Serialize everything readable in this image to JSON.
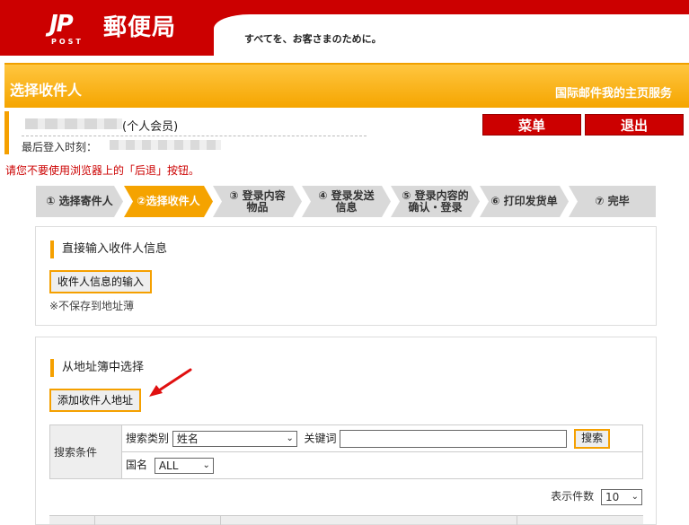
{
  "header": {
    "logo_mark": "JP",
    "logo_sub": "POST",
    "brand_name": "郵便局",
    "slogan": "すべてを、お客さまのために。"
  },
  "titlebar": {
    "page_title": "选择收件人",
    "service_link": "国际邮件我的主页服务"
  },
  "user": {
    "member_type": "(个人会员)",
    "last_login_label": "最后登入时刻："
  },
  "buttons": {
    "menu": "菜单",
    "logout": "退出"
  },
  "warning": "请您不要使用浏览器上的「后退」按钮。",
  "steps": [
    {
      "label": "① 选择寄件人",
      "active": false
    },
    {
      "label": "②选择收件人",
      "active": true
    },
    {
      "label": "③ 登录内容\n物品",
      "active": false
    },
    {
      "label": "④ 登录发送\n信息",
      "active": false
    },
    {
      "label": "⑤ 登录内容的\n确认・登录",
      "active": false
    },
    {
      "label": "⑥ 打印发货单",
      "active": false
    },
    {
      "label": "⑦ 完毕",
      "active": false
    }
  ],
  "direct_input": {
    "title": "直接输入收件人信息",
    "button": "收件人信息的输入",
    "note": "※不保存到地址薄"
  },
  "address_book": {
    "title": "从地址簿中选择",
    "add_button": "添加收件人地址",
    "search": {
      "condition_label": "搜索条件",
      "category_label": "搜索类别",
      "category_value": "姓名",
      "keyword_label": "关键词",
      "keyword_value": "",
      "search_button": "搜索",
      "country_label": "国名",
      "country_value": "ALL"
    },
    "display_count_label": "表示件数",
    "display_count_value": "10"
  },
  "colors": {
    "brand_red": "#cc0000",
    "accent_orange": "#f5a300",
    "step_inactive": "#d9d9d9"
  }
}
